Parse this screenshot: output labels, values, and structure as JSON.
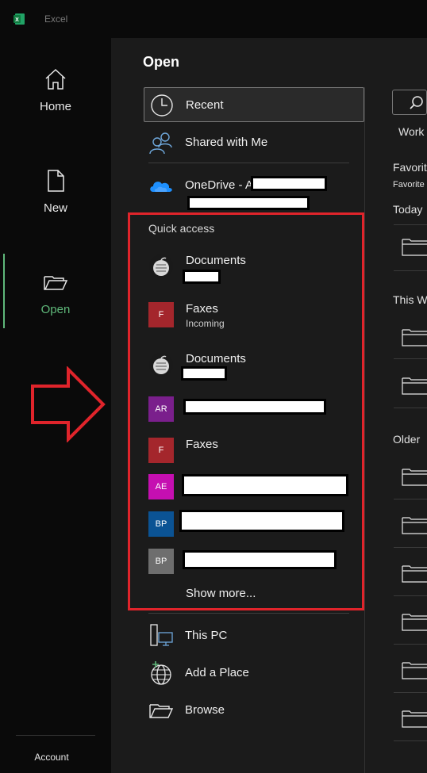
{
  "app": {
    "title": "Excel",
    "icon": "excel-logo-icon",
    "brand_color": "#107c41"
  },
  "nav": {
    "items": [
      {
        "label": "Home",
        "icon": "home-icon"
      },
      {
        "label": "New",
        "icon": "new-document-icon"
      },
      {
        "label": "Open",
        "icon": "open-folder-icon",
        "active": true
      }
    ],
    "account_label": "Account",
    "active_color": "#5fb87a"
  },
  "page": {
    "title": "Open"
  },
  "locations": [
    {
      "label": "Recent",
      "icon": "clock-icon",
      "selected": true
    },
    {
      "label": "Shared with Me",
      "icon": "people-icon"
    },
    {
      "label": "OneDrive - A",
      "icon": "onedrive-cloud-icon"
    }
  ],
  "quick_access": {
    "title": "Quick access",
    "items": [
      {
        "name": "Documents",
        "sub": "",
        "badge": "",
        "icon": "apple-drive-icon"
      },
      {
        "name": "Faxes",
        "sub": "Incoming",
        "badge": "F",
        "badge_color": "#a4262c"
      },
      {
        "name": "Documents",
        "sub": "",
        "badge": "",
        "icon": "apple-drive-icon"
      },
      {
        "name": "",
        "sub": "",
        "badge": "AR",
        "badge_color": "#7a1f8c"
      },
      {
        "name": "Faxes",
        "sub": "",
        "badge": "F",
        "badge_color": "#a4262c"
      },
      {
        "name": "",
        "sub": "",
        "badge": "AE",
        "badge_color": "#c50fb1"
      },
      {
        "name": "",
        "sub": "",
        "badge": "BP",
        "badge_color": "#0b5394"
      },
      {
        "name": "",
        "sub": "",
        "badge": "BP",
        "badge_color": "#6e6e6e"
      }
    ],
    "show_more": "Show more..."
  },
  "other_locations": [
    {
      "label": "This PC",
      "icon": "computer-icon"
    },
    {
      "label": "Add a Place",
      "icon": "globe-add-icon"
    },
    {
      "label": "Browse",
      "icon": "browse-folder-icon"
    }
  ],
  "annotation": {
    "highlight_color": "#e0242b"
  },
  "right": {
    "tab": "Work",
    "favorites_heading": "Favorit",
    "favorites_text": "Favorite",
    "groups": [
      "Today",
      "This W",
      "Older"
    ]
  }
}
